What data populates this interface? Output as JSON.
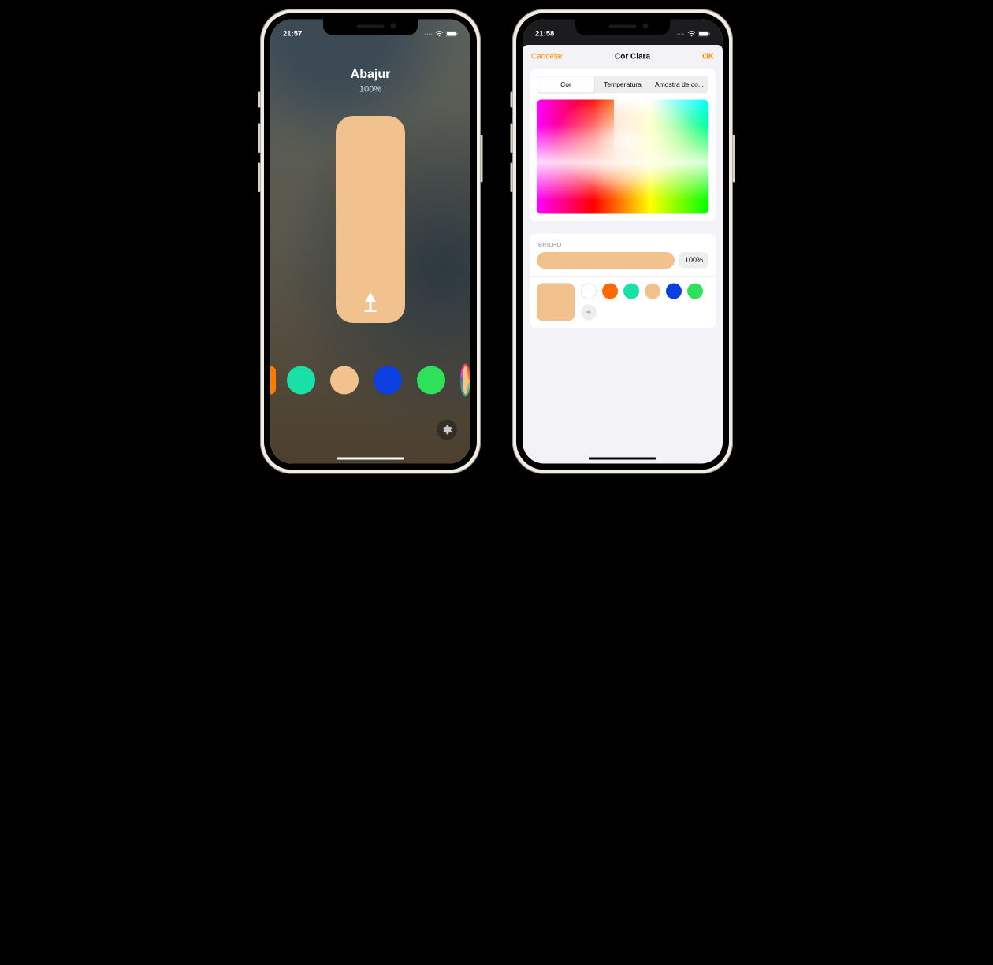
{
  "phone1": {
    "status": {
      "time": "21:57"
    },
    "light": {
      "name": "Abajur",
      "brightness_label": "100%",
      "slider_color": "#f2c28e",
      "icon": "lamp-icon"
    },
    "swatches": [
      {
        "name": "orange-partial",
        "color": "#ff7a00",
        "partial": true
      },
      {
        "name": "teal",
        "color": "#19e0a6"
      },
      {
        "name": "peach",
        "color": "#f2c28e"
      },
      {
        "name": "blue",
        "color": "#0b3fe0"
      },
      {
        "name": "green",
        "color": "#2ee05a"
      },
      {
        "name": "custom-color",
        "color": "#f2c28e",
        "rainbow": true
      }
    ],
    "settings_icon": "gear-icon"
  },
  "phone2": {
    "status": {
      "time": "21:58"
    },
    "nav": {
      "cancel": "Cancelar",
      "title": "Cor Clara",
      "ok": "OK"
    },
    "segmented": {
      "items": [
        "Cor",
        "Temperatura",
        "Amostra de co..."
      ],
      "selected_index": 0
    },
    "brightness": {
      "section_label": "BRILHO",
      "value_label": "100%",
      "bar_color": "#f2c28e",
      "percent": 100
    },
    "current_color": "#f2c28e",
    "preset_swatches": [
      {
        "name": "white",
        "color": "#ffffff"
      },
      {
        "name": "orange",
        "color": "#ff6a00"
      },
      {
        "name": "teal",
        "color": "#19e0a6"
      },
      {
        "name": "peach",
        "color": "#f2c28e"
      },
      {
        "name": "blue",
        "color": "#0b3fe0"
      },
      {
        "name": "green",
        "color": "#2ee05a"
      }
    ],
    "add_label": "+"
  },
  "colors": {
    "accent_orange": "#ff9500"
  }
}
